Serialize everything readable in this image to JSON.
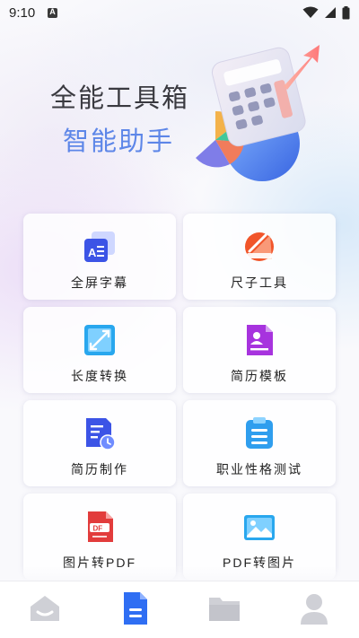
{
  "status_bar": {
    "time": "9:10",
    "icons": [
      "notification-a-icon",
      "wifi-icon",
      "signal-icon",
      "battery-icon"
    ]
  },
  "hero": {
    "title": "全能工具箱",
    "subtitle": "智能助手"
  },
  "tools": [
    {
      "label": "全屏字幕",
      "icon": "subtitle-icon",
      "color": "#3c54e6"
    },
    {
      "label": "尺子工具",
      "icon": "ruler-icon",
      "color": "#f1552a"
    },
    {
      "label": "长度转换",
      "icon": "length-convert-icon",
      "color": "#29a7ee"
    },
    {
      "label": "简历模板",
      "icon": "resume-template-icon",
      "color": "#a733de"
    },
    {
      "label": "简历制作",
      "icon": "resume-make-icon",
      "color": "#3c54e6"
    },
    {
      "label": "职业性格测试",
      "icon": "clipboard-test-icon",
      "color": "#2f9eee"
    },
    {
      "label": "图片转PDF",
      "icon": "image-to-pdf-icon",
      "color": "#e23c3c"
    },
    {
      "label": "PDF转图片",
      "icon": "pdf-to-image-icon",
      "color": "#29a7ee"
    }
  ],
  "tabbar": {
    "tabs": [
      {
        "icon": "home-icon",
        "active": false
      },
      {
        "icon": "document-icon",
        "active": true
      },
      {
        "icon": "folder-icon",
        "active": false
      },
      {
        "icon": "profile-icon",
        "active": false
      }
    ],
    "active_color": "#2f6ef3",
    "inactive_color": "#cfd0d6"
  }
}
